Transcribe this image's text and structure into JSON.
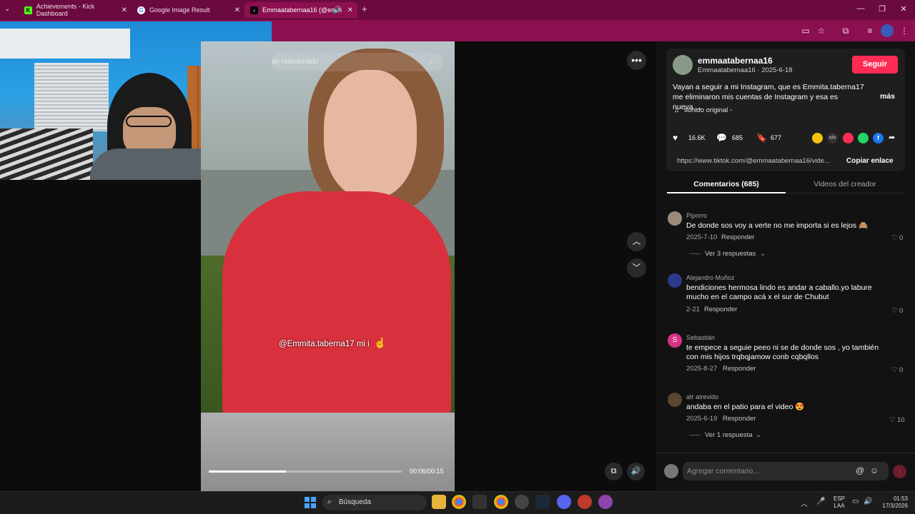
{
  "browser": {
    "tabs": [
      {
        "title": "Achievements - Kick Dashboard",
        "favicon": "kick-icon"
      },
      {
        "title": "Google Image Result",
        "favicon": "google-icon"
      },
      {
        "title": "Emmaatabernaa16 (@emm",
        "favicon": "tiktok-icon"
      }
    ],
    "new_tab": "+"
  },
  "video": {
    "search_placeholder": "do relacionado",
    "caption_overlay": "@Emmita.taberna17 mi i",
    "time": "00:06/00:15",
    "progress": 0.4
  },
  "post": {
    "username": "emmaatabernaa16",
    "sub": "Emmaatabernaa16 · 2025-6-18",
    "follow_label": "Seguir",
    "description": "Vayan a seguir a mi Instagram, que es Emmita.taberna17 me eliminaron mis cuentas de Instagram y esa es nueva,...",
    "more_label": "más",
    "sound": "sonido original -",
    "likes": "16.6K",
    "comments": "685",
    "saves": "677",
    "url": "https://www.tiktok.com/@emmaatabernaa16/vide...",
    "copy_label": "Copiar enlace"
  },
  "tabs": {
    "comments": "Comentarios (685)",
    "creator_videos": "Videos del creador"
  },
  "comments": [
    {
      "name": "Piporro",
      "text": "De donde sos voy a verte no me importa si es lejos 🙈",
      "date": "2025-7-10",
      "reply": "Responder",
      "likes": "0",
      "thread": "Ver 3 respuestas"
    },
    {
      "name": "Alejandro Muñoz",
      "text": "bendiciones hermosa lindo es andar a caballo.yo labure mucho en el campo acá x el sur de Chubut",
      "date": "2-21",
      "reply": "Responder",
      "likes": "0",
      "thread": ""
    },
    {
      "name": "Sebastián",
      "text": "te empece a seguie peeo ni se de donde sos , yo también con mis hijos trqbqjamow conb cqbqllos",
      "date": "2025-8-27",
      "reply": "Responder",
      "likes": "0",
      "thread": ""
    },
    {
      "name": "atr atrevido",
      "text": "andaba en el patio para el video 😍",
      "date": "2025-6-19",
      "reply": "Responder",
      "likes": "10",
      "thread": "Ver 1 respuesta"
    }
  ],
  "comment_input": {
    "placeholder": "Agregar comentario..."
  },
  "taskbar": {
    "search": "Búsqueda",
    "lang1": "ESP",
    "lang2": "LAA",
    "time": "01:53",
    "date": "17/3/2026"
  },
  "colors": {
    "accent": "#fe2c55",
    "chrome": "#6b0a3e"
  }
}
